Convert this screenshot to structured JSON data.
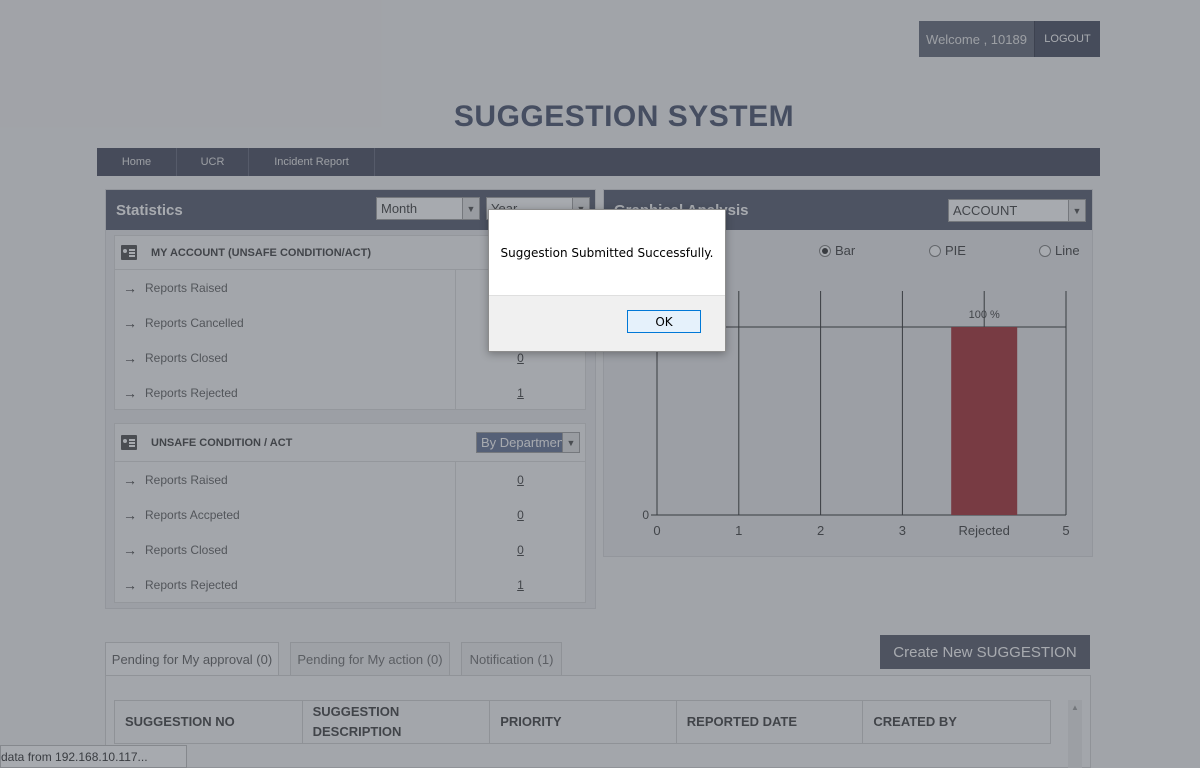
{
  "header": {
    "welcome": "Welcome , 10189",
    "logout": "LOGOUT",
    "title": "SUGGESTION SYSTEM"
  },
  "nav": [
    {
      "label": "Home"
    },
    {
      "label": "UCR"
    },
    {
      "label": "Incident Report"
    }
  ],
  "statistics": {
    "title": "Statistics",
    "month_select": "Month",
    "year_select": "Year",
    "my_account": {
      "heading": "MY ACCOUNT (UNSAFE CONDITION/ACT)",
      "rows": [
        {
          "label": "Reports Raised",
          "value": ""
        },
        {
          "label": "Reports Cancelled",
          "value": ""
        },
        {
          "label": "Reports Closed",
          "value": "0"
        },
        {
          "label": "Reports Rejected",
          "value": "1"
        }
      ]
    },
    "unsafe": {
      "heading": "UNSAFE CONDITION / ACT",
      "filter": "By Departmen",
      "rows": [
        {
          "label": "Reports Raised",
          "value": "0"
        },
        {
          "label": "Reports Accpeted",
          "value": "0"
        },
        {
          "label": "Reports Closed",
          "value": "0"
        },
        {
          "label": "Reports Rejected",
          "value": "1"
        }
      ]
    }
  },
  "graph": {
    "title": "Graphical Analysis",
    "account_select": "ACCOUNT",
    "radios": [
      {
        "label": "Bar",
        "checked": true
      },
      {
        "label": "PIE",
        "checked": false
      },
      {
        "label": "Line",
        "checked": false
      }
    ],
    "bar_color": "#a02026"
  },
  "chart_data": {
    "type": "bar",
    "x_ticks": [
      "0",
      "1",
      "2",
      "3",
      "Rejected",
      "5"
    ],
    "y_ticks": [
      "0"
    ],
    "categories": [
      "Rejected"
    ],
    "values": [
      100
    ],
    "data_labels": [
      "100 %"
    ],
    "xlim": [
      0,
      5
    ],
    "ylim": [
      0,
      100
    ],
    "grid": true
  },
  "tabs": [
    {
      "label": "Pending for My approval (0)",
      "active": true
    },
    {
      "label": "Pending for My action (0)",
      "active": false
    },
    {
      "label": "Notification (1)",
      "active": false
    }
  ],
  "create_button": "Create New SUGGESTION",
  "table": {
    "columns": [
      "SUGGESTION NO",
      "SUGGESTION DESCRIPTION",
      "PRIORITY",
      "REPORTED DATE",
      "CREATED BY"
    ]
  },
  "statusbar": "data from 192.168.10.117...",
  "dialog": {
    "message": "Suggestion Submitted Successfully.",
    "ok": "OK"
  }
}
